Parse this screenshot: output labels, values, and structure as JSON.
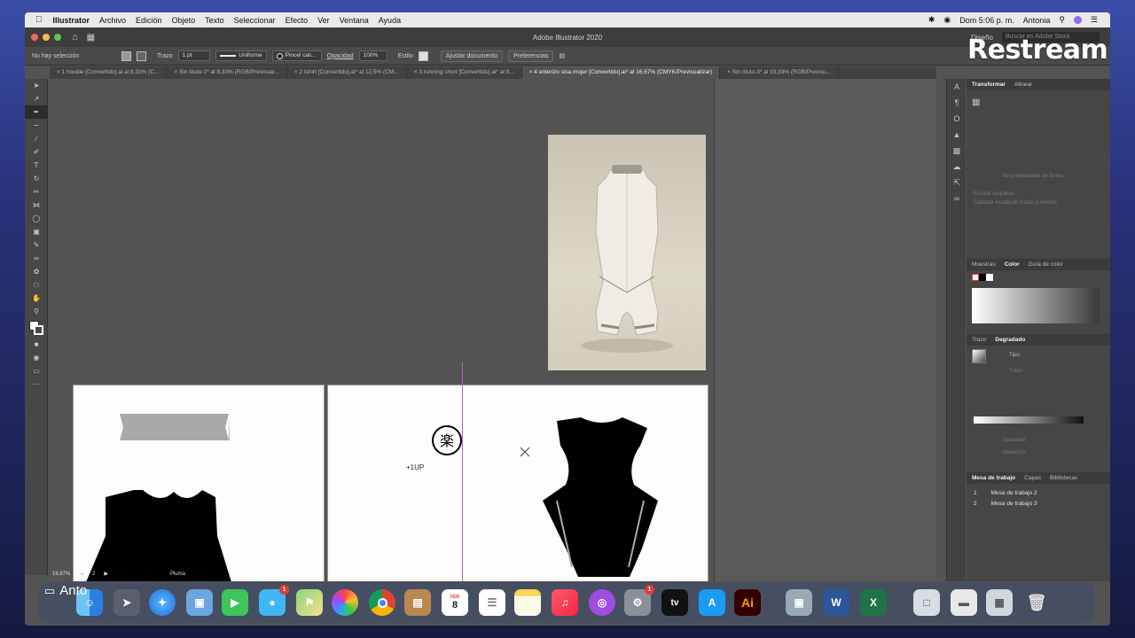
{
  "menubar": {
    "app": "Illustrator",
    "items": [
      "Archivo",
      "Edición",
      "Objeto",
      "Texto",
      "Seleccionar",
      "Efecto",
      "Ver",
      "Ventana",
      "Ayuda"
    ],
    "clock": "Dom 5:06 p. m.",
    "user": "Antonia"
  },
  "titlebar": {
    "title": "Adobe Illustrator 2020",
    "workspace": "Diseño",
    "search_placeholder": "Buscar en Adobe Stock"
  },
  "controlbar": {
    "selection": "No hay selección",
    "stroke_label": "Trazo",
    "stroke_value": "1 pt",
    "profile": "Uniforme",
    "brush": "Pincel cali...",
    "opacity_label": "Opacidad",
    "opacity_value": "100%",
    "style_label": "Estilo",
    "adjust_btn": "Ajustar documento",
    "prefs_btn": "Preferencias"
  },
  "tabs": [
    "1 hoodie [Convertido].ai al 8,33% (C...",
    "Sin título-1* al 8,33% (RGB/Previsual...",
    "2 tshirt [Convertido].ai* al 12,5% (CM...",
    "3 running short [Convertido].ai* al 8...",
    "4 enterizo sisa mujer [Convertido].ai* al 16,67% (CMYK/Previsualizar)",
    "Sin título-3* al 33,33% (RGB/Previsu..."
  ],
  "active_tab_index": 4,
  "canvas": {
    "label_1up": "+1UP"
  },
  "statusbar": {
    "zoom": "16,67%",
    "page": "2",
    "tool": "Pluma"
  },
  "panels": {
    "transform_tabs": [
      "Transformar",
      "Alinear"
    ],
    "no_props": "Sin propiedades de forma",
    "scale_strokes": "Escalar esquinas",
    "scale_effects": "Cambiar escala de trazos y efectos",
    "color_tabs": [
      "Muestras",
      "Color",
      "Guía de color"
    ],
    "gradient_tabs": [
      "Trazo",
      "Degradado"
    ],
    "gradient_type": "Tipo:",
    "gradient_stroke": "Trazo:",
    "opacity": "Opacidad:",
    "location": "Ubicación:",
    "artboard_tabs": [
      "Mesa de trabajo",
      "Capas",
      "Bibliotecas"
    ],
    "artboards": [
      {
        "num": "1",
        "name": "Mesa de trabajo 2"
      },
      {
        "num": "2",
        "name": "Mesa de trabajo 3"
      }
    ]
  },
  "overlay": {
    "brand": "Restream",
    "streamer": "Anto"
  },
  "dock": {
    "calendar_month": "FEB",
    "calendar_day": "8",
    "appletv": "tv",
    "illustrator": "Ai",
    "badge_messages": "1",
    "badge_settings": "1"
  },
  "colors": {
    "accent_guide": "#b45cc9",
    "ai_orange": "#ff9a00",
    "ai_bg": "#330000"
  }
}
